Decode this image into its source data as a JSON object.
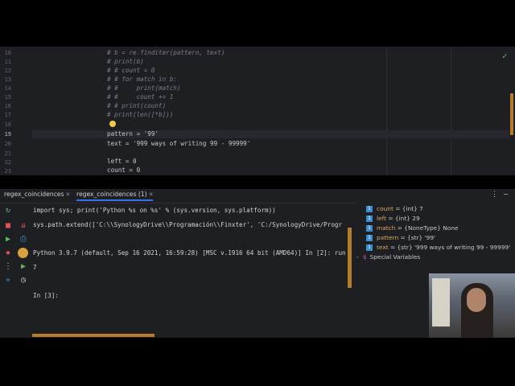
{
  "editor": {
    "line_numbers": [
      "10",
      "11",
      "12",
      "13",
      "14",
      "15",
      "16",
      "17",
      "18",
      "19",
      "20",
      "21",
      "22",
      "23"
    ],
    "current_line": "19",
    "lines": [
      {
        "text": "# b = re.finditer(pattern, text)",
        "kind": "cmt"
      },
      {
        "text": "# print(b)",
        "kind": "cmt"
      },
      {
        "text": "# # count = 0",
        "kind": "cmt"
      },
      {
        "text": "# # for match in b:",
        "kind": "cmt"
      },
      {
        "text": "# #     print(match)",
        "kind": "cmt"
      },
      {
        "text": "# #     count += 1",
        "kind": "cmt"
      },
      {
        "text": "# # print(count)",
        "kind": "cmt"
      },
      {
        "text": "# print(len([*b]))",
        "kind": "cmt"
      },
      {
        "text": "",
        "kind": "cmt"
      },
      {
        "text": "pattern = '99'",
        "kind": "code"
      },
      {
        "text": "text = '999 ways of writing 99 - 99999'",
        "kind": "code"
      },
      {
        "text": "",
        "kind": "code"
      },
      {
        "text": "left = 0",
        "kind": "code"
      },
      {
        "text": "count = 0",
        "kind": "code"
      }
    ],
    "status_icon": "check-icon"
  },
  "console": {
    "tabs": [
      {
        "label": "regex_coincidences",
        "active": false
      },
      {
        "label": "regex_coincidences (1)",
        "active": true
      }
    ],
    "output": [
      "import sys; print('Python %s on %s' % (sys.version, sys.platform))",
      "sys.path.extend(['C:\\\\SynologyDrive\\\\Programación\\\\Finxter', 'C:/SynologyDrive/Progr",
      "",
      "Python 3.9.7 (default, Sep 16 2021, 16:59:28) [MSC v.1916 64 bit (AMD64)] In [2]: run",
      "7",
      "",
      "",
      "In [3]:"
    ],
    "toolbar_icons": [
      "rerun-icon",
      "stop-icon",
      "run-icon",
      "settings-gear-icon",
      "more-icon",
      "add-icon",
      "scroll-down-icon",
      "print-icon",
      "python-icon",
      "forward-icon",
      "history-icon"
    ]
  },
  "variables": [
    {
      "name": "count",
      "value": " = {int} 7"
    },
    {
      "name": "left",
      "value": " = {int} 29"
    },
    {
      "name": "match",
      "value": " = {NoneType} None"
    },
    {
      "name": "pattern",
      "value": " = {str} '99'"
    },
    {
      "name": "text",
      "value": " = {str} '999 ways of writing 99 - 99999'"
    }
  ],
  "special_variables_label": "Special Variables",
  "colors": {
    "background": "#1e1f22",
    "comment": "#7a7e85",
    "string": "#6aab73",
    "number": "#2aacb8",
    "accent": "#3574f0",
    "scroll": "#b57c2a"
  }
}
